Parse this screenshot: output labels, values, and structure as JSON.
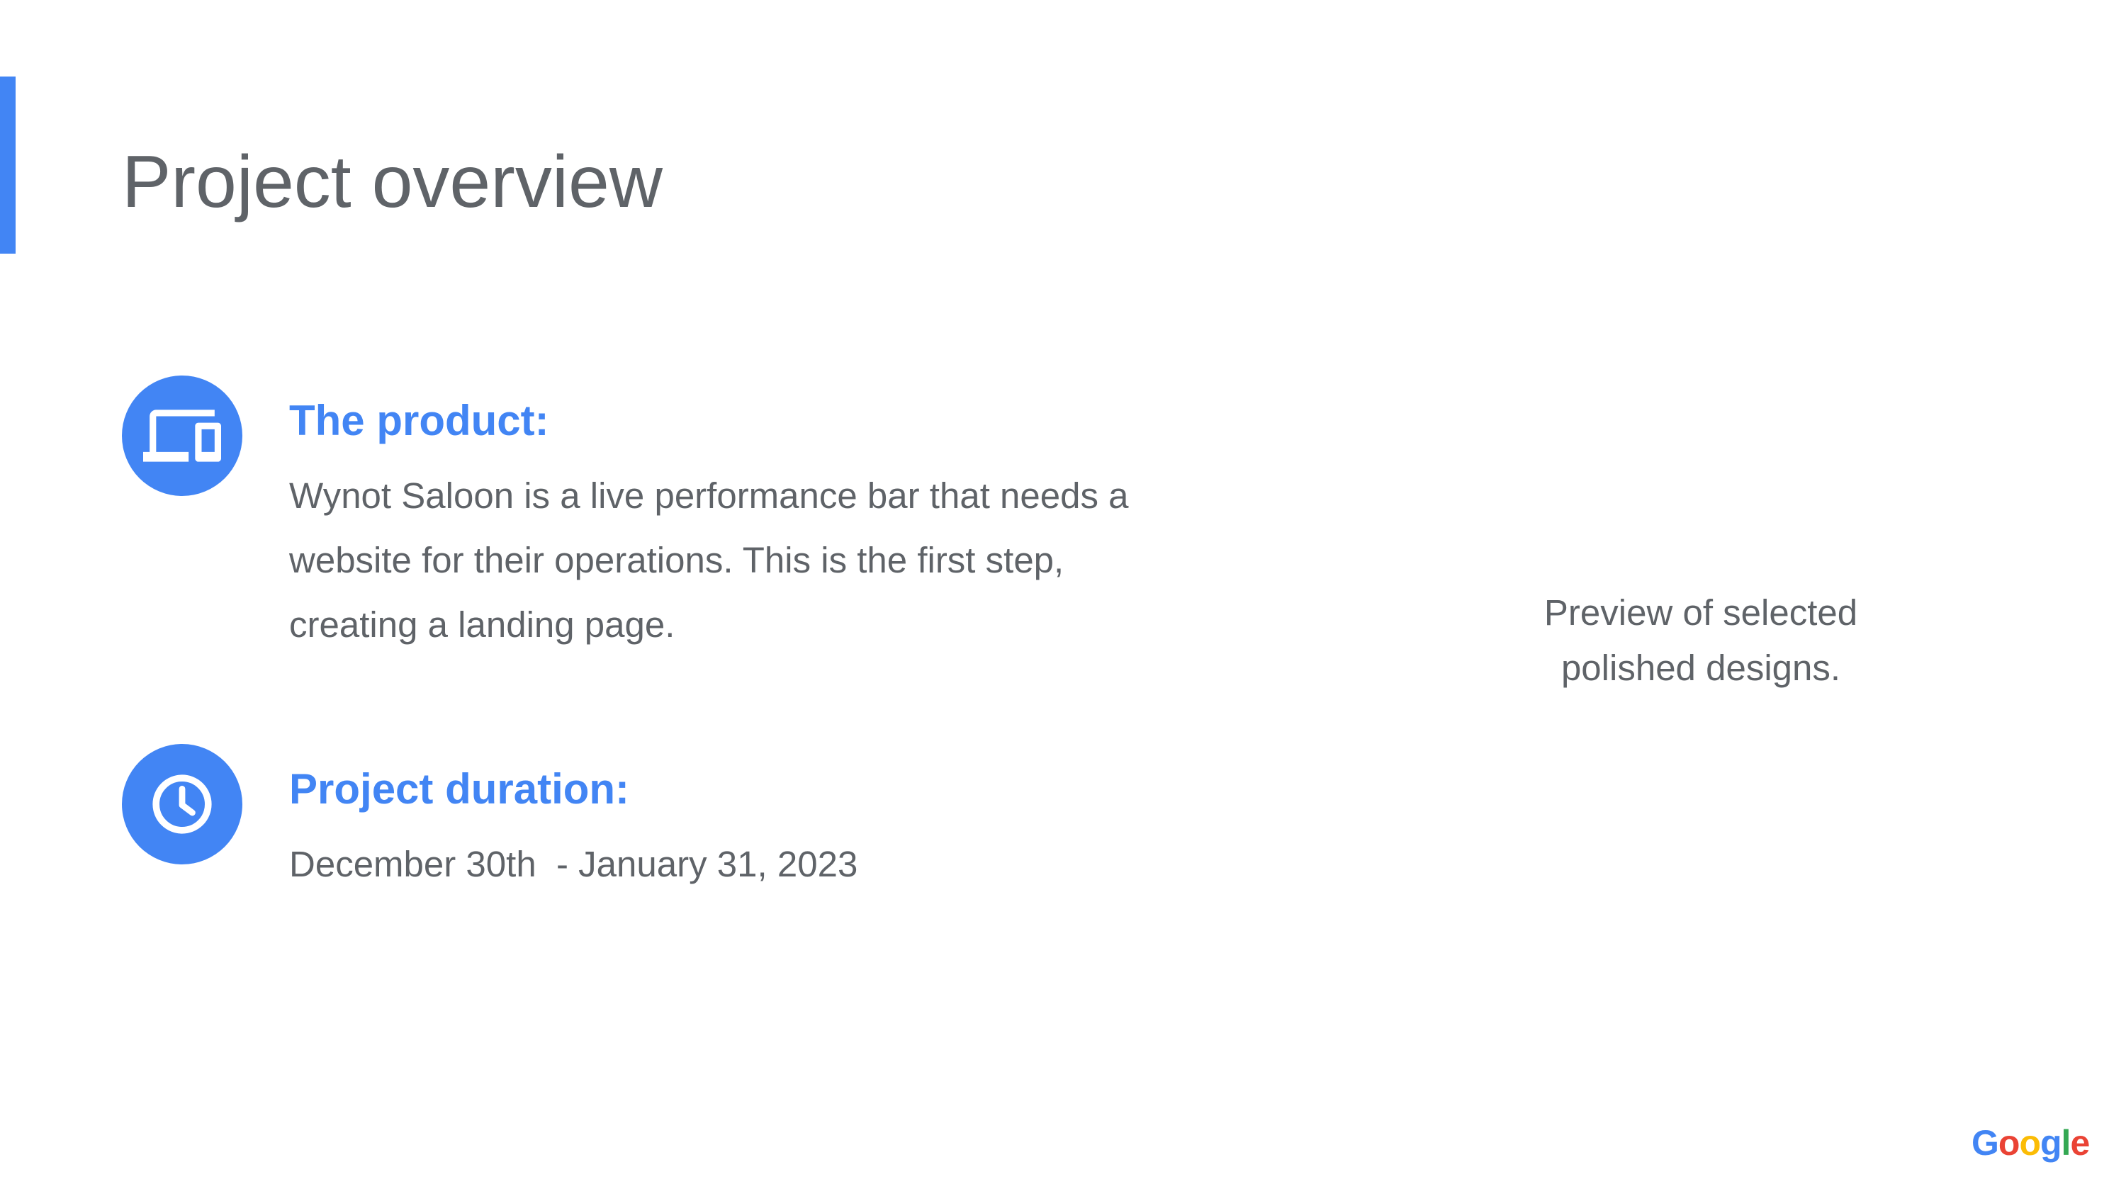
{
  "slide": {
    "title": "Project overview",
    "accent_color": "#4285f4",
    "text_color": "#5f6368"
  },
  "sections": [
    {
      "icon": "devices-icon",
      "heading": "The product:",
      "body": "Wynot Saloon is a live performance bar that needs a website for their operations. This is the first step, creating a landing page."
    },
    {
      "icon": "clock-icon",
      "heading": "Project duration:",
      "body": "December 30th  - January 31, 2023"
    }
  ],
  "preview": {
    "caption": "Preview of selected\npolished designs."
  },
  "logo": {
    "text": "Google",
    "letters": [
      {
        "char": "G",
        "color": "#4285f4"
      },
      {
        "char": "o",
        "color": "#ea4335"
      },
      {
        "char": "o",
        "color": "#fbbc05"
      },
      {
        "char": "g",
        "color": "#4285f4"
      },
      {
        "char": "l",
        "color": "#34a853"
      },
      {
        "char": "e",
        "color": "#ea4335"
      }
    ]
  }
}
